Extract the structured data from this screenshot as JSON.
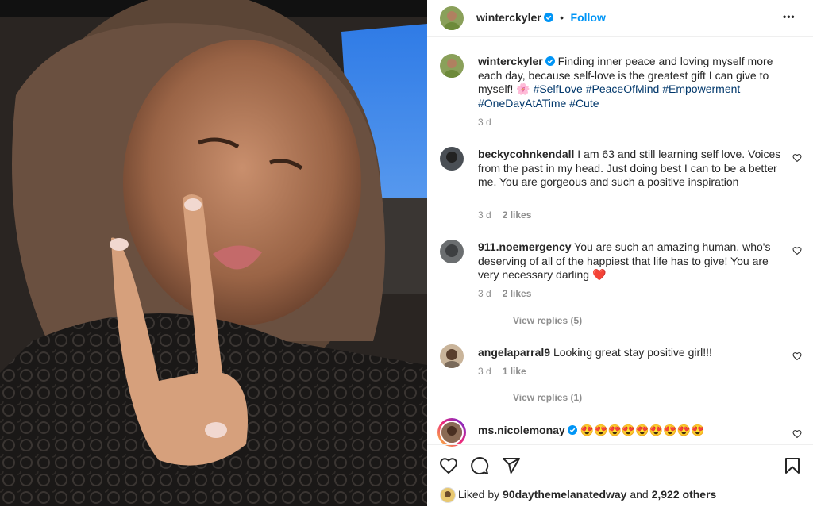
{
  "post": {
    "username": "winterckyler",
    "follow_label": "Follow",
    "dot": "•",
    "more_label": "•••",
    "caption_text": "Finding inner peace and loving myself more each day, because self-love is the greatest gift I can give to myself! 🌸",
    "hashtags": [
      "#SelfLove",
      "#PeaceOfMind",
      "#Empowerment",
      "#OneDayAtATime",
      "#Cute"
    ],
    "caption_time": "3 d"
  },
  "comments": [
    {
      "username": "beckycohnkendall",
      "text": "I am 63 and still learning self love. Voices from the past in my head. Just doing best I can to be a better me. You are gorgeous and such a positive inspiration",
      "time": "3 d",
      "likes": "2 likes"
    },
    {
      "username": "911.noemergency",
      "text": "You are such an amazing human, who's deserving of all of the happiest that life has to give! You are very necessary darling ❤️",
      "time": "3 d",
      "likes": "2 likes",
      "view_replies": "View replies (5)"
    },
    {
      "username": "angelaparral9",
      "text": "Looking great stay positive girl!!!",
      "time": "3 d",
      "likes": "1 like",
      "view_replies": "View replies (1)"
    },
    {
      "username": "ms.nicolemonay",
      "text": "😍😍😍😍😍😍😍😍😍",
      "verified": true
    }
  ],
  "likes": {
    "prefix": "Liked by",
    "liker": "90daythemelanatedway",
    "connector": "and",
    "others": "2,922 others"
  },
  "icons": [
    "heart-icon",
    "comment-icon",
    "share-icon",
    "bookmark-icon",
    "verified-icon",
    "more-icon"
  ],
  "colors": {
    "accent": "#0095f6",
    "verified": "#0095f6",
    "hashtag": "#00376b",
    "muted": "#8e8e8e",
    "heart_red": "#ed4956"
  }
}
